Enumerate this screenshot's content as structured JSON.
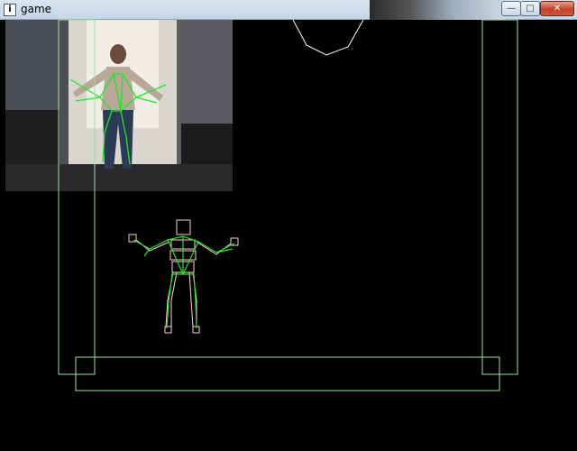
{
  "window": {
    "title": "game",
    "icon": "app-icon",
    "controls": {
      "minimize": "—",
      "maximize": "□",
      "close": "✕"
    }
  },
  "colors": {
    "wireframe": "#9fe09f",
    "skeleton": "#22e622",
    "avatar": "#ffd0d0",
    "shape": "#ffffff"
  }
}
